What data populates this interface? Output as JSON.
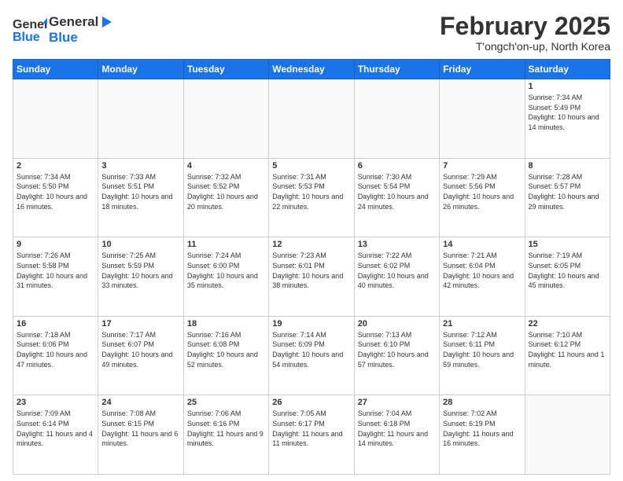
{
  "logo": {
    "general": "General",
    "blue": "Blue"
  },
  "title": "February 2025",
  "location": "T'ongch'on-up, North Korea",
  "days_header": [
    "Sunday",
    "Monday",
    "Tuesday",
    "Wednesday",
    "Thursday",
    "Friday",
    "Saturday"
  ],
  "weeks": [
    [
      {
        "day": "",
        "info": ""
      },
      {
        "day": "",
        "info": ""
      },
      {
        "day": "",
        "info": ""
      },
      {
        "day": "",
        "info": ""
      },
      {
        "day": "",
        "info": ""
      },
      {
        "day": "",
        "info": ""
      },
      {
        "day": "1",
        "info": "Sunrise: 7:34 AM\nSunset: 5:49 PM\nDaylight: 10 hours and 14 minutes."
      }
    ],
    [
      {
        "day": "2",
        "info": "Sunrise: 7:34 AM\nSunset: 5:50 PM\nDaylight: 10 hours and 16 minutes."
      },
      {
        "day": "3",
        "info": "Sunrise: 7:33 AM\nSunset: 5:51 PM\nDaylight: 10 hours and 18 minutes."
      },
      {
        "day": "4",
        "info": "Sunrise: 7:32 AM\nSunset: 5:52 PM\nDaylight: 10 hours and 20 minutes."
      },
      {
        "day": "5",
        "info": "Sunrise: 7:31 AM\nSunset: 5:53 PM\nDaylight: 10 hours and 22 minutes."
      },
      {
        "day": "6",
        "info": "Sunrise: 7:30 AM\nSunset: 5:54 PM\nDaylight: 10 hours and 24 minutes."
      },
      {
        "day": "7",
        "info": "Sunrise: 7:29 AM\nSunset: 5:56 PM\nDaylight: 10 hours and 26 minutes."
      },
      {
        "day": "8",
        "info": "Sunrise: 7:28 AM\nSunset: 5:57 PM\nDaylight: 10 hours and 29 minutes."
      }
    ],
    [
      {
        "day": "9",
        "info": "Sunrise: 7:26 AM\nSunset: 5:58 PM\nDaylight: 10 hours and 31 minutes."
      },
      {
        "day": "10",
        "info": "Sunrise: 7:25 AM\nSunset: 5:59 PM\nDaylight: 10 hours and 33 minutes."
      },
      {
        "day": "11",
        "info": "Sunrise: 7:24 AM\nSunset: 6:00 PM\nDaylight: 10 hours and 35 minutes."
      },
      {
        "day": "12",
        "info": "Sunrise: 7:23 AM\nSunset: 6:01 PM\nDaylight: 10 hours and 38 minutes."
      },
      {
        "day": "13",
        "info": "Sunrise: 7:22 AM\nSunset: 6:02 PM\nDaylight: 10 hours and 40 minutes."
      },
      {
        "day": "14",
        "info": "Sunrise: 7:21 AM\nSunset: 6:04 PM\nDaylight: 10 hours and 42 minutes."
      },
      {
        "day": "15",
        "info": "Sunrise: 7:19 AM\nSunset: 6:05 PM\nDaylight: 10 hours and 45 minutes."
      }
    ],
    [
      {
        "day": "16",
        "info": "Sunrise: 7:18 AM\nSunset: 6:06 PM\nDaylight: 10 hours and 47 minutes."
      },
      {
        "day": "17",
        "info": "Sunrise: 7:17 AM\nSunset: 6:07 PM\nDaylight: 10 hours and 49 minutes."
      },
      {
        "day": "18",
        "info": "Sunrise: 7:16 AM\nSunset: 6:08 PM\nDaylight: 10 hours and 52 minutes."
      },
      {
        "day": "19",
        "info": "Sunrise: 7:14 AM\nSunset: 6:09 PM\nDaylight: 10 hours and 54 minutes."
      },
      {
        "day": "20",
        "info": "Sunrise: 7:13 AM\nSunset: 6:10 PM\nDaylight: 10 hours and 57 minutes."
      },
      {
        "day": "21",
        "info": "Sunrise: 7:12 AM\nSunset: 6:11 PM\nDaylight: 10 hours and 59 minutes."
      },
      {
        "day": "22",
        "info": "Sunrise: 7:10 AM\nSunset: 6:12 PM\nDaylight: 11 hours and 1 minute."
      }
    ],
    [
      {
        "day": "23",
        "info": "Sunrise: 7:09 AM\nSunset: 6:14 PM\nDaylight: 11 hours and 4 minutes."
      },
      {
        "day": "24",
        "info": "Sunrise: 7:08 AM\nSunset: 6:15 PM\nDaylight: 11 hours and 6 minutes."
      },
      {
        "day": "25",
        "info": "Sunrise: 7:06 AM\nSunset: 6:16 PM\nDaylight: 11 hours and 9 minutes."
      },
      {
        "day": "26",
        "info": "Sunrise: 7:05 AM\nSunset: 6:17 PM\nDaylight: 11 hours and 11 minutes."
      },
      {
        "day": "27",
        "info": "Sunrise: 7:04 AM\nSunset: 6:18 PM\nDaylight: 11 hours and 14 minutes."
      },
      {
        "day": "28",
        "info": "Sunrise: 7:02 AM\nSunset: 6:19 PM\nDaylight: 11 hours and 16 minutes."
      },
      {
        "day": "",
        "info": ""
      }
    ]
  ]
}
